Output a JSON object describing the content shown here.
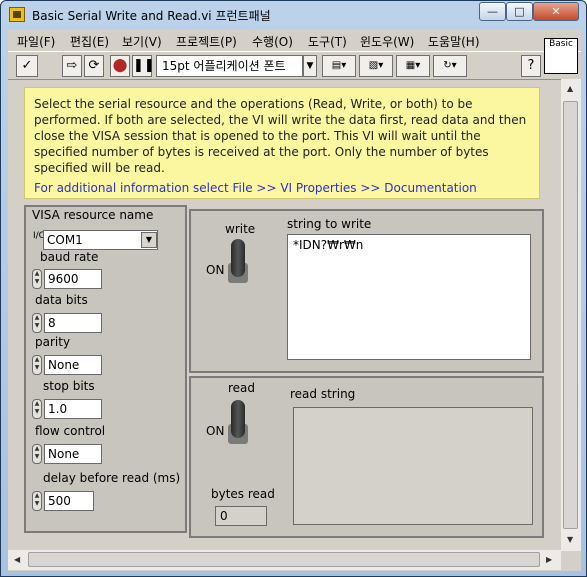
{
  "window": {
    "title": "Basic Serial Write and Read.vi 프런트패널"
  },
  "menu": [
    "파일(F)",
    "편집(E)",
    "보기(V)",
    "프로젝트(P)",
    "수행(O)",
    "도구(T)",
    "윈도우(W)",
    "도움말(H)"
  ],
  "toolbar": {
    "font": "15pt 어플리케이션 폰트",
    "help": "?",
    "icon_label": "Basic"
  },
  "note": {
    "text": "Select the serial resource and the operations (Read, Write, or both) to be performed.  If both are selected, the VI will write the data first, read data and then close the VISA session that is opened to the port.  This VI will wait until the specified number of bytes is received at the port. Only the number of bytes specified will be read.",
    "link": "For additional information select File >> VI Properties >> Documentation"
  },
  "controls": {
    "visa_label": "VISA resource name",
    "visa_value": "COM1",
    "visa_prefix": "I/O",
    "baud_label": "baud rate",
    "baud_value": "9600",
    "data_bits_label": "data bits",
    "data_bits_value": "8",
    "parity_label": "parity",
    "parity_value": "None",
    "stop_bits_label": "stop bits",
    "stop_bits_value": "1.0",
    "flow_label": "flow control",
    "flow_value": "None",
    "delay_label": "delay before read (ms)",
    "delay_value": "500"
  },
  "write": {
    "label": "write",
    "state": "ON",
    "string_label": "string to write",
    "string_value": "*IDN?₩r₩n"
  },
  "read": {
    "label": "read",
    "state": "ON",
    "string_label": "read string",
    "bytes_label": "bytes read",
    "bytes_value": "0"
  }
}
